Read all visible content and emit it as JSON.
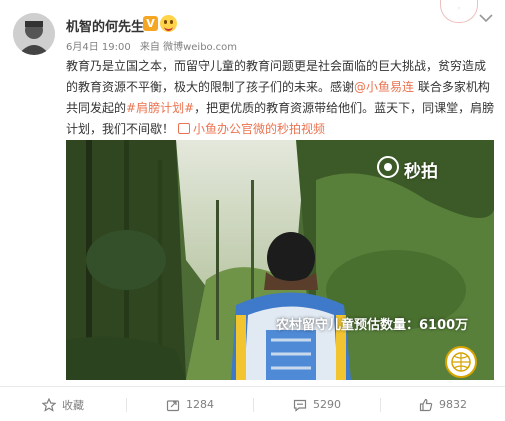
{
  "author": {
    "name": "机智的何先生",
    "vip_badge": "V"
  },
  "meta": {
    "date": "6月4日 19:00",
    "source": "来自 微博weibo.com"
  },
  "post": {
    "text_1": "教育乃是立国之本，而留守儿童的教育问题更是社会面临的巨大挑战，贫穷造成的教育资源不平衡，极大的限制了孩子们的未来。感谢",
    "mention": "@小鱼易连",
    "text_2": " 联合多家机构共同发起的",
    "topic": "#肩膀计划#",
    "text_3": "，把更优质的教育资源带给他们。蓝天下，同课堂，肩膀计划，我们不间歇！",
    "video_link": "小鱼办公官微的秒拍视频"
  },
  "video": {
    "watermark": "秒拍",
    "caption": "农村留守儿童预估数量：6100万"
  },
  "actions": {
    "favorite": "收藏",
    "repost": "1284",
    "comment": "5290",
    "like": "9832"
  },
  "colors": {
    "link": "#eb7350",
    "text": "#333333",
    "meta": "#808080"
  }
}
